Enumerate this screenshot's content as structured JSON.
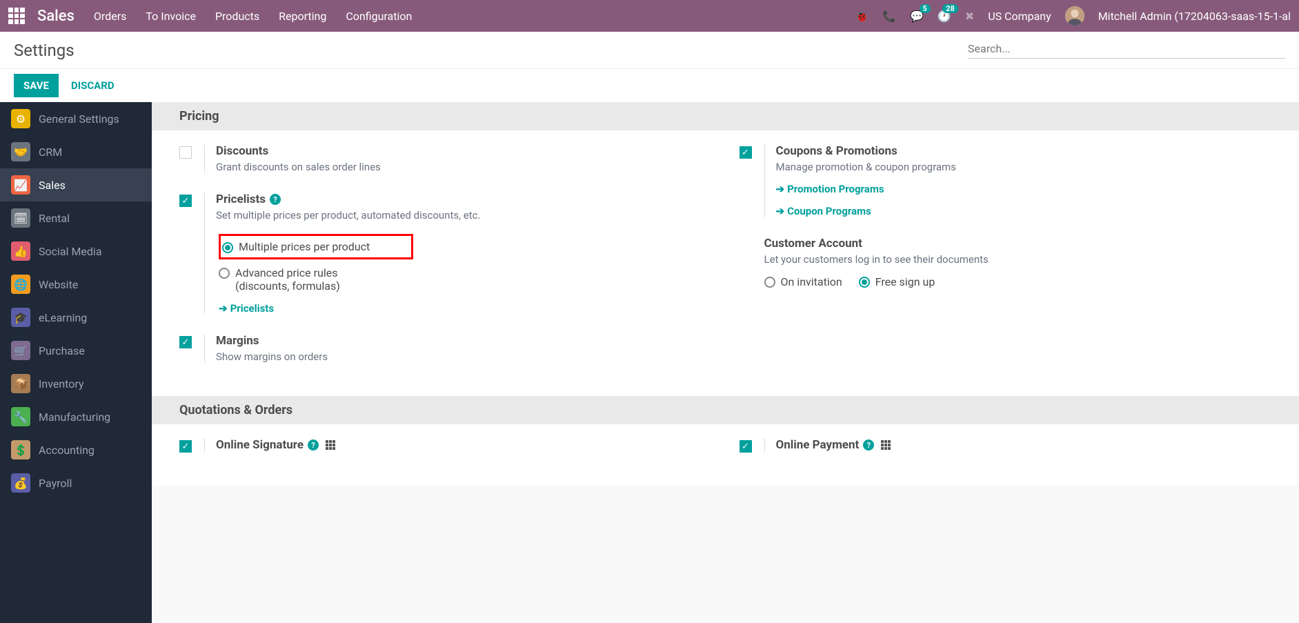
{
  "topbar": {
    "brand": "Sales",
    "nav": [
      "Orders",
      "To Invoice",
      "Products",
      "Reporting",
      "Configuration"
    ],
    "msg_count": "5",
    "activity_count": "28",
    "company": "US Company",
    "user": "Mitchell Admin (17204063-saas-15-1-al"
  },
  "secondbar": {
    "title": "Settings",
    "search_placeholder": "Search..."
  },
  "actions": {
    "save": "SAVE",
    "discard": "DISCARD"
  },
  "sidebar": {
    "items": [
      {
        "label": "General Settings",
        "icon": "⚙",
        "bg": "#e8b200"
      },
      {
        "label": "CRM",
        "icon": "🤝",
        "bg": "#6c757d"
      },
      {
        "label": "Sales",
        "icon": "📈",
        "bg": "#f06543",
        "active": true
      },
      {
        "label": "Rental",
        "icon": "🗓",
        "bg": "#6c757d"
      },
      {
        "label": "Social Media",
        "icon": "👍",
        "bg": "#e05d6f"
      },
      {
        "label": "Website",
        "icon": "🌐",
        "bg": "#f29c1f"
      },
      {
        "label": "eLearning",
        "icon": "🎓",
        "bg": "#5b5ea6"
      },
      {
        "label": "Purchase",
        "icon": "🛒",
        "bg": "#7e6b8f"
      },
      {
        "label": "Inventory",
        "icon": "📦",
        "bg": "#a67c52"
      },
      {
        "label": "Manufacturing",
        "icon": "🔧",
        "bg": "#4caf50"
      },
      {
        "label": "Accounting",
        "icon": "💲",
        "bg": "#c49a6c"
      },
      {
        "label": "Payroll",
        "icon": "💰",
        "bg": "#5b5ea6"
      }
    ]
  },
  "sections": {
    "pricing": {
      "title": "Pricing",
      "discounts": {
        "title": "Discounts",
        "desc": "Grant discounts on sales order lines",
        "checked": false
      },
      "coupons": {
        "title": "Coupons & Promotions",
        "desc": "Manage promotion & coupon programs",
        "checked": true,
        "link1": "Promotion Programs",
        "link2": "Coupon Programs"
      },
      "pricelists": {
        "title": "Pricelists",
        "desc": "Set multiple prices per product, automated discounts, etc.",
        "checked": true,
        "opt1": "Multiple prices per product",
        "opt2a": "Advanced price rules",
        "opt2b": "(discounts, formulas)",
        "link": "Pricelists"
      },
      "customer_account": {
        "title": "Customer Account",
        "desc": "Let your customers log in to see their documents",
        "opt1": "On invitation",
        "opt2": "Free sign up"
      },
      "margins": {
        "title": "Margins",
        "desc": "Show margins on orders",
        "checked": true
      }
    },
    "quotations": {
      "title": "Quotations & Orders",
      "online_sig": {
        "title": "Online Signature",
        "checked": true
      },
      "online_pay": {
        "title": "Online Payment",
        "checked": true
      }
    }
  }
}
